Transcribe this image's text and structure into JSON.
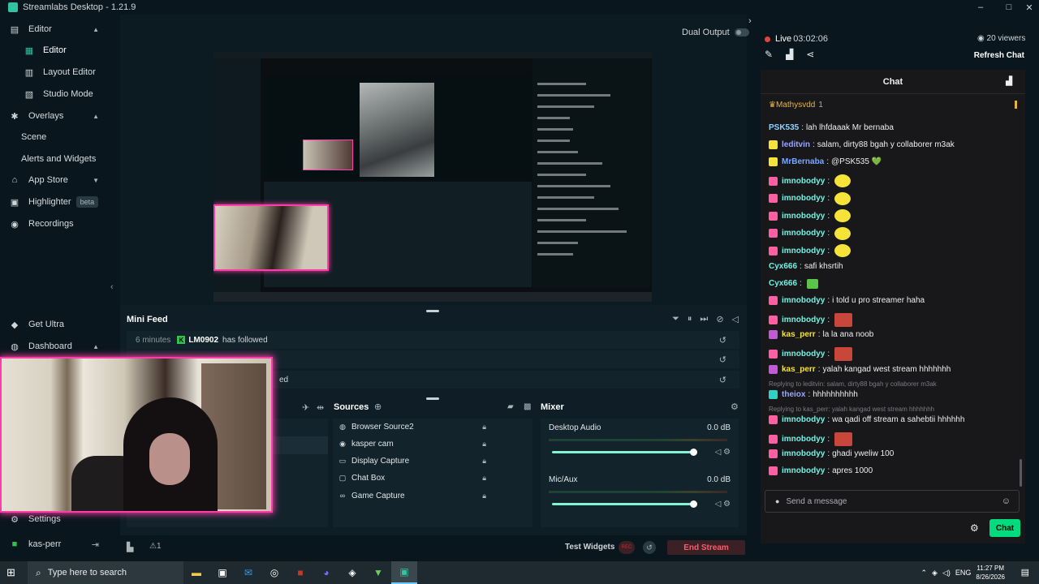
{
  "window": {
    "title": "Streamlabs Desktop - 1.21.9",
    "minimize": "–",
    "maximize": "□",
    "close": "✕"
  },
  "sidebar": {
    "editor": "Editor",
    "editor_sub": "Editor",
    "layout_editor": "Layout Editor",
    "studio_mode": "Studio Mode",
    "overlays": "Overlays",
    "scene": "Scene",
    "alerts": "Alerts and Widgets",
    "app_store": "App Store",
    "highlighter": "Highlighter",
    "highlighter_badge": "beta",
    "recordings": "Recordings",
    "get_ultra": "Get Ultra",
    "dashboard": "Dashboard",
    "settings": "Settings",
    "user": "kas-perr"
  },
  "header": {
    "dual_output": "Dual Output"
  },
  "minifeed": {
    "title": "Mini Feed",
    "items": [
      {
        "time": "6 minutes",
        "user": "LM0902",
        "action": "has followed"
      },
      {
        "time": "",
        "user": "",
        "action": ""
      },
      {
        "time": "",
        "user": "",
        "action": "ed"
      }
    ]
  },
  "sources": {
    "title": "Sources",
    "items": [
      {
        "name": "Browser Source2",
        "icon": "globe-icon"
      },
      {
        "name": "kasper cam",
        "icon": "camera-icon"
      },
      {
        "name": "Display Capture",
        "icon": "monitor-icon"
      },
      {
        "name": "Chat Box",
        "icon": "chat-icon"
      },
      {
        "name": "Game Capture",
        "icon": "gamepad-icon"
      }
    ]
  },
  "mixer": {
    "title": "Mixer",
    "channels": [
      {
        "name": "Desktop Audio",
        "db": "0.0 dB",
        "level": 0.97
      },
      {
        "name": "Mic/Aux",
        "db": "0.0 dB",
        "level": 0.97
      }
    ]
  },
  "footer": {
    "test_widgets": "Test Widgets",
    "rec": "REC",
    "end_stream": "End Stream",
    "alert_count": "1"
  },
  "stream": {
    "status": "Live",
    "duration": "03:02:06",
    "viewers": "20 viewers",
    "refresh_chat": "Refresh Chat"
  },
  "chat": {
    "title": "Chat",
    "pinned_user": "Mathysvdd",
    "pinned_count": "1",
    "messages": [
      {
        "user": "PSK535",
        "text": "lah lhfdaaak Mr bernaba",
        "color": "#8fd3ff",
        "badge": "",
        "emote": ""
      },
      {
        "user": "leditvin",
        "text": "salam, dirty88 bgah y collaborer m3ak",
        "color": "#9aa6ff",
        "badge": "yellow",
        "emote": ""
      },
      {
        "user": "MrBernaba",
        "text": "@PSK535 💚",
        "color": "#7aa8ff",
        "badge": "yellow",
        "emote": ""
      },
      {
        "user": "imnobodyy",
        "text": "",
        "color": "#6ff2e3",
        "badge": "pink",
        "emote": "yellow"
      },
      {
        "user": "imnobodyy",
        "text": "",
        "color": "#6ff2e3",
        "badge": "pink",
        "emote": "yellow"
      },
      {
        "user": "imnobodyy",
        "text": "",
        "color": "#6ff2e3",
        "badge": "pink",
        "emote": "yellow"
      },
      {
        "user": "imnobodyy",
        "text": "",
        "color": "#6ff2e3",
        "badge": "pink",
        "emote": "yellow"
      },
      {
        "user": "imnobodyy",
        "text": "",
        "color": "#6ff2e3",
        "badge": "pink",
        "emote": "yellow"
      },
      {
        "user": "Cyx666",
        "text": "safi khsrtih",
        "color": "#6ff2e3",
        "badge": "",
        "emote": ""
      },
      {
        "user": "Cyx666",
        "text": "",
        "color": "#6ff2e3",
        "badge": "",
        "emote": "green"
      },
      {
        "user": "imnobodyy",
        "text": "i told u pro streamer haha",
        "color": "#6ff2e3",
        "badge": "pink",
        "emote": ""
      },
      {
        "user": "imnobodyy",
        "text": "",
        "color": "#6ff2e3",
        "badge": "pink",
        "emote": "red"
      },
      {
        "user": "kas_perr",
        "text": "la la ana noob",
        "color": "#f5e33a",
        "badge": "mic",
        "emote": ""
      },
      {
        "user": "imnobodyy",
        "text": "",
        "color": "#6ff2e3",
        "badge": "pink",
        "emote": "red"
      },
      {
        "user": "kas_perr",
        "text": "yalah kangad west stream hhhhhhh",
        "color": "#f5e33a",
        "badge": "mic",
        "emote": ""
      },
      {
        "user": "theiox",
        "text": "hhhhhhhhhh",
        "color": "#9aa6ff",
        "badge": "teal",
        "emote": "",
        "reply": "Replying to leditvin: salam, dirty88 bgah y collaborer m3ak"
      },
      {
        "user": "imnobodyy",
        "text": "wa qadi off stream a sahebtii hhhhhh",
        "color": "#6ff2e3",
        "badge": "pink",
        "emote": "",
        "reply": "Replying to kas_perr: yalah kangad west stream hhhhhhh"
      },
      {
        "user": "imnobodyy",
        "text": "",
        "color": "#6ff2e3",
        "badge": "pink",
        "emote": "red"
      },
      {
        "user": "imnobodyy",
        "text": "ghadi yweliw 100",
        "color": "#6ff2e3",
        "badge": "pink",
        "emote": ""
      },
      {
        "user": "imnobodyy",
        "text": "apres 1000",
        "color": "#6ff2e3",
        "badge": "pink",
        "emote": ""
      }
    ],
    "input_placeholder": "Send a message",
    "send": "Chat"
  },
  "taskbar": {
    "search_placeholder": "Type here to search",
    "lang": "ENG",
    "time": "11:27 PM",
    "date": "8/26/2026"
  }
}
